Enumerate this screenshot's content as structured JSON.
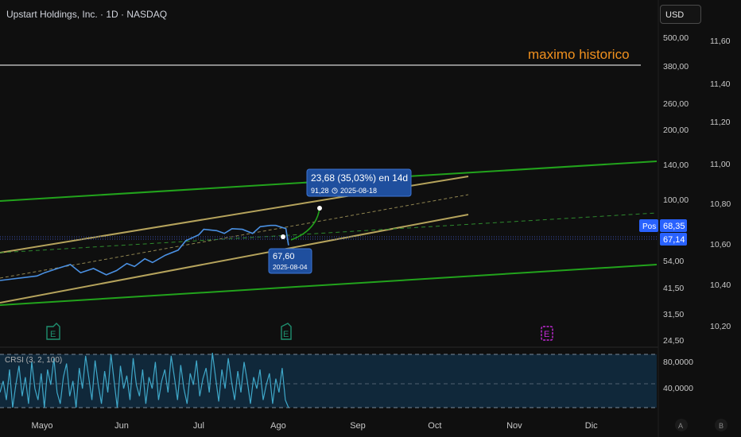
{
  "header": {
    "symbol_title": "Upstart Holdings, Inc. · 1D · NASDAQ",
    "currency_button": "USD"
  },
  "annotations": {
    "ath_label": "maximo historico",
    "measure_label": "23,68 (35,03%) en 14d",
    "measure_sub_value": "91,28",
    "measure_sub_date": "2025-08-18",
    "point_value": "67,60",
    "point_date": "2025-08-04",
    "pos_label": "Pos",
    "earnings_icon_letter": "E",
    "indicator_label": "CRSI (3, 2, 100)",
    "scale_buttons": [
      "A",
      "B"
    ]
  },
  "colors": {
    "background": "#0f0f0f",
    "price_line": "#4a90e2",
    "outer_channel": "#22a31c",
    "inner_channel": "#b5a35c",
    "dashed_mid": "#2e8a2e",
    "ath_line": "#8a8a8a",
    "ath_text": "#f0901e",
    "tooltip_bg": "#1f4f9e",
    "tooltip_border": "#3c76d4",
    "price_label_bg": "#2962ff",
    "earnings_green": "#1f8f6f",
    "earnings_purple": "#c22ad6",
    "crsi_line": "#3fa8c9",
    "crsi_band": "#10283a",
    "dotted_price": "#3a4fb0"
  },
  "chart_data": {
    "type": "line",
    "title": "Upstart Holdings, Inc. · 1D · NASDAQ",
    "scale": "log",
    "x_labels": [
      "Mayo",
      "Jun",
      "Jul",
      "Ago",
      "Sep",
      "Oct",
      "Nov",
      "Dic"
    ],
    "y_ticks_left": [
      "500,00",
      "380,00",
      "260,00",
      "200,00",
      "140,00",
      "100,00",
      "54,00",
      "41,50",
      "31,50",
      "24,50"
    ],
    "y_ticks_right": [
      "11,60",
      "11,40",
      "11,20",
      "11,00",
      "10,80",
      "10,60",
      "10,40",
      "10,20"
    ],
    "price_labels": [
      "68,35",
      "67,14"
    ],
    "ath_level": 380,
    "series": [
      {
        "name": "",
        "x": [
          "2025-04-24",
          "2025-04-29",
          "2025-05-02",
          "2025-05-07",
          "2025-05-12",
          "2025-05-16",
          "2025-05-21",
          "2025-05-26",
          "2025-05-30",
          "2025-06-03",
          "2025-06-06",
          "2025-06-10",
          "2025-06-13",
          "2025-06-18",
          "2025-06-23",
          "2025-06-26",
          "2025-07-01",
          "2025-07-03",
          "2025-07-08",
          "2025-07-11",
          "2025-07-14",
          "2025-07-18",
          "2025-07-22",
          "2025-07-25",
          "2025-07-29",
          "2025-07-31",
          "2025-08-04",
          "2025-08-05"
        ],
        "values": [
          44.5,
          46.5,
          48.0,
          50.0,
          52.0,
          48.0,
          50.0,
          47.0,
          49.0,
          52.5,
          51.0,
          55.0,
          53.0,
          57.0,
          60.0,
          66.0,
          70.0,
          74.0,
          73.0,
          71.0,
          74.5,
          74.0,
          71.0,
          76.0,
          77.0,
          77.0,
          74.5,
          63.0
        ]
      }
    ],
    "indicator": {
      "name": "CRSI (3, 2, 100)",
      "y_ticks": [
        "80,0000",
        "40,0000"
      ],
      "band": [
        20,
        90
      ],
      "values": [
        40,
        55,
        30,
        70,
        20,
        50,
        75,
        35,
        60,
        25,
        80,
        45,
        30,
        65,
        20,
        70,
        50,
        85,
        40,
        25,
        60,
        78,
        35,
        55,
        20,
        72,
        45,
        88,
        60,
        30,
        82,
        50,
        25,
        68,
        40,
        90,
        55,
        20,
        75,
        45,
        62,
        30,
        85,
        50,
        35,
        70,
        25,
        60,
        45,
        80,
        30,
        55,
        70,
        40,
        88,
        60,
        30,
        76,
        45,
        25,
        65,
        50,
        82,
        35,
        58,
        72,
        40,
        92,
        60,
        28,
        70,
        45,
        85,
        55,
        30,
        68,
        40,
        80,
        55,
        25,
        60,
        45,
        70,
        30,
        50,
        65,
        25,
        58,
        40,
        72,
        30,
        20
      ]
    }
  }
}
